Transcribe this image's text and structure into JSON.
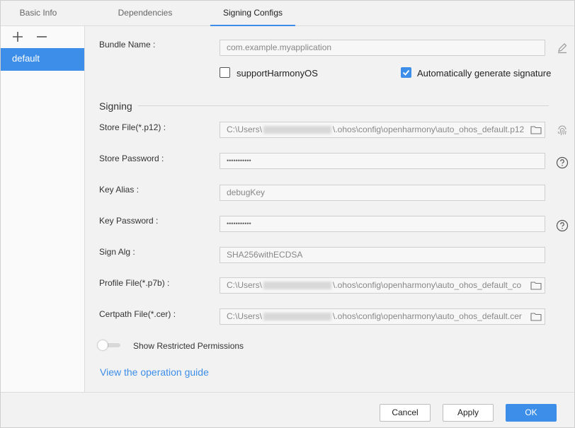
{
  "tabs": [
    {
      "label": "Basic Info"
    },
    {
      "label": "Dependencies"
    },
    {
      "label": "Signing Configs"
    }
  ],
  "sidebar": {
    "add_icon": "plus-icon",
    "remove_icon": "minus-icon",
    "items": [
      {
        "label": "default"
      }
    ]
  },
  "form": {
    "bundle_name": {
      "label": "Bundle Name :",
      "value": "com.example.myapplication"
    },
    "support_harmony": {
      "label": "supportHarmonyOS",
      "checked": false
    },
    "auto_sign": {
      "label": "Automatically generate signature",
      "checked": true
    },
    "signing_title": "Signing",
    "store_file": {
      "label": "Store File(*.p12) :",
      "prefix": "C:\\Users\\",
      "suffix": "\\.ohos\\config\\openharmony\\auto_ohos_default.p12"
    },
    "store_password": {
      "label": "Store Password :",
      "value": "•••••••••••"
    },
    "key_alias": {
      "label": "Key Alias :",
      "value": "debugKey"
    },
    "key_password": {
      "label": "Key Password :",
      "value": "•••••••••••"
    },
    "sign_alg": {
      "label": "Sign Alg :",
      "value": "SHA256withECDSA"
    },
    "profile_file": {
      "label": "Profile File(*.p7b) :",
      "prefix": "C:\\Users\\",
      "suffix": "\\.ohos\\config\\openharmony\\auto_ohos_default_co"
    },
    "certpath_file": {
      "label": "Certpath File(*.cer) :",
      "prefix": "C:\\Users\\",
      "suffix": "\\.ohos\\config\\openharmony\\auto_ohos_default.cer"
    },
    "restricted": {
      "label": "Show Restricted Permissions",
      "enabled": false
    },
    "guide_link": "View the operation guide"
  },
  "footer": {
    "cancel": "Cancel",
    "apply": "Apply",
    "ok": "OK"
  },
  "colors": {
    "accent": "#3d8ee8",
    "background": "#f2f2f2"
  }
}
